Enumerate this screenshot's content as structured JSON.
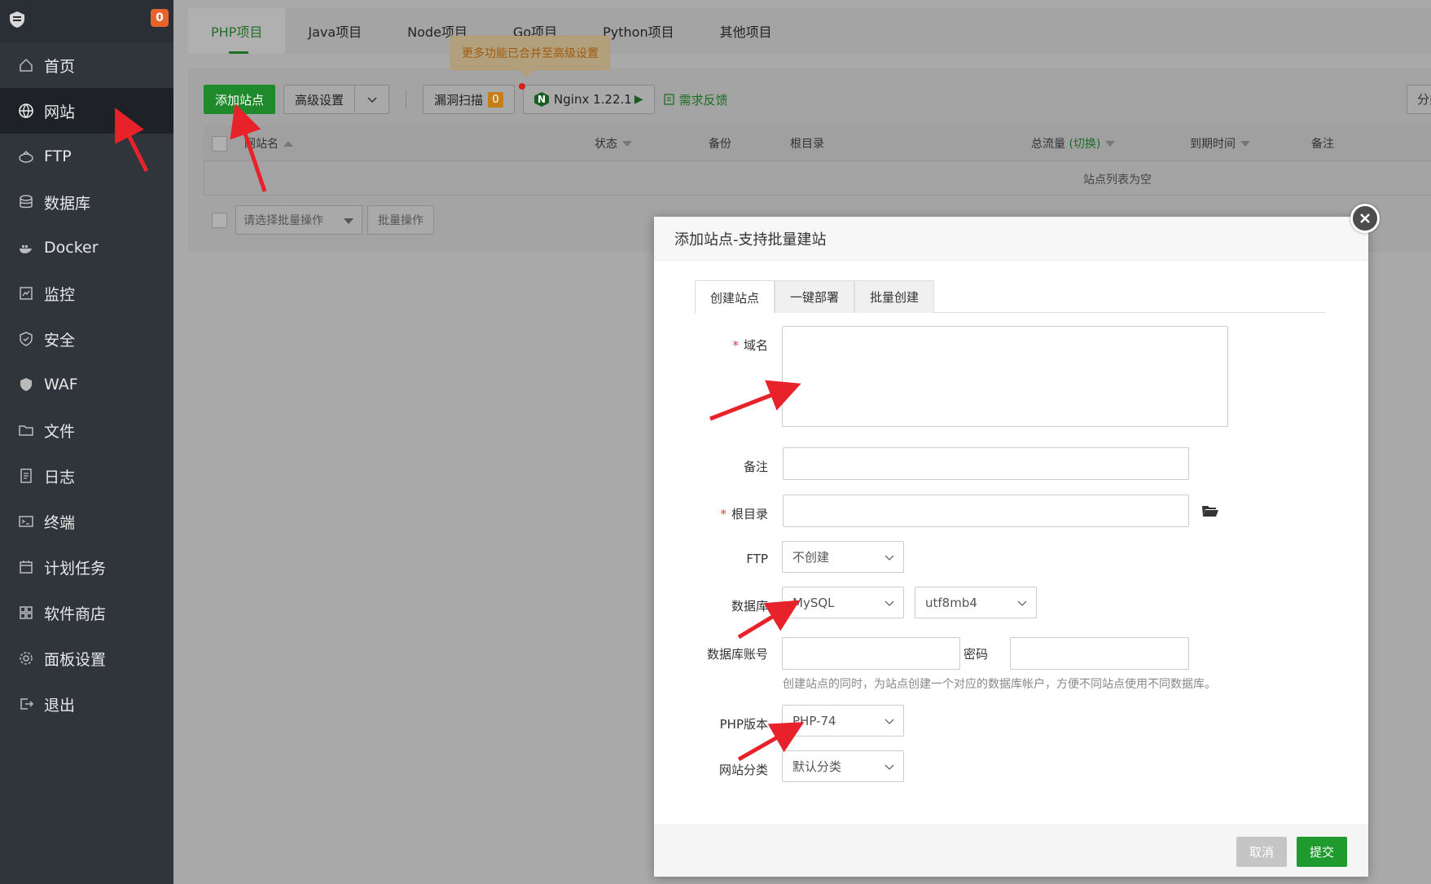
{
  "sidebar": {
    "badge": "0",
    "items": [
      {
        "label": "首页",
        "icon": "home-icon"
      },
      {
        "label": "网站",
        "icon": "globe-icon"
      },
      {
        "label": "FTP",
        "icon": "ftp-icon"
      },
      {
        "label": "数据库",
        "icon": "database-icon"
      },
      {
        "label": "Docker",
        "icon": "docker-icon"
      },
      {
        "label": "监控",
        "icon": "monitor-icon"
      },
      {
        "label": "安全",
        "icon": "shield-icon"
      },
      {
        "label": "WAF",
        "icon": "waf-icon"
      },
      {
        "label": "文件",
        "icon": "folder-icon"
      },
      {
        "label": "日志",
        "icon": "log-icon"
      },
      {
        "label": "终端",
        "icon": "terminal-icon"
      },
      {
        "label": "计划任务",
        "icon": "calendar-icon"
      },
      {
        "label": "软件商店",
        "icon": "apps-icon"
      },
      {
        "label": "面板设置",
        "icon": "gear-icon"
      },
      {
        "label": "退出",
        "icon": "logout-icon"
      }
    ],
    "active_index": 1
  },
  "tabs": [
    "PHP项目",
    "Java项目",
    "Node项目",
    "Go项目",
    "Python项目",
    "其他项目"
  ],
  "toolbar": {
    "add_site": "添加站点",
    "advanced": "高级设置",
    "tooltip": "更多功能已合并至高级设置",
    "scan": "漏洞扫描",
    "scan_count": "0",
    "nginx": "Nginx 1.22.1",
    "feedback": "需求反馈",
    "right_btn": "分类"
  },
  "table": {
    "headers": {
      "name": "网站名",
      "status": "状态",
      "backup": "备份",
      "root": "根目录",
      "traffic": "总流量",
      "traffic_switch": "(切换)",
      "expire": "到期时间",
      "note": "备注"
    },
    "empty": "站点列表为空"
  },
  "batch": {
    "select_placeholder": "请选择批量操作",
    "button": "批量操作"
  },
  "modal": {
    "title": "添加站点-支持批量建站",
    "tabs": [
      "创建站点",
      "一键部署",
      "批量创建"
    ],
    "labels": {
      "domain": "域名",
      "note": "备注",
      "root": "根目录",
      "ftp": "FTP",
      "db": "数据库",
      "db_account": "数据库账号",
      "password": "密码",
      "php": "PHP版本",
      "category": "网站分类"
    },
    "values": {
      "ftp": "不创建",
      "db": "MySQL",
      "charset": "utf8mb4",
      "php": "PHP-74",
      "category": "默认分类"
    },
    "hint": "创建站点的同时，为站点创建一个对应的数据库帐户，方便不同站点使用不同数据库。",
    "cancel": "取消",
    "submit": "提交"
  },
  "colors": {
    "accent": "#1e9a2f",
    "arrow": "#e8222b",
    "sidebar": "#30353c"
  }
}
